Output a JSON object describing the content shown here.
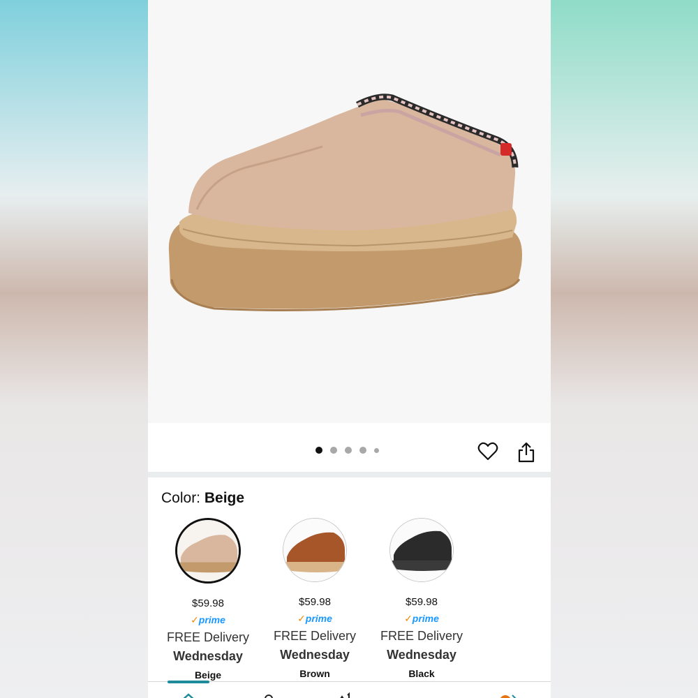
{
  "product": {
    "image_pager": {
      "total": 5,
      "active_index": 0
    }
  },
  "color": {
    "label": "Color:",
    "selected_value": "Beige"
  },
  "swatches": [
    {
      "price": "$59.98",
      "prime_label": "prime",
      "delivery_label": "FREE Delivery",
      "delivery_day": "Wednesday",
      "color_name": "Beige",
      "selected": true
    },
    {
      "price": "$59.98",
      "prime_label": "prime",
      "delivery_label": "FREE Delivery",
      "delivery_day": "Wednesday",
      "color_name": "Brown",
      "selected": false
    },
    {
      "price": "$59.98",
      "prime_label": "prime",
      "delivery_label": "FREE Delivery",
      "delivery_day": "Wednesday",
      "color_name": "Black",
      "selected": false
    }
  ],
  "icons": {
    "wishlist": "heart-icon",
    "share": "share-icon",
    "nav": [
      "home-icon",
      "profile-icon",
      "cart-icon",
      "menu-icon",
      "rufus-icon"
    ]
  },
  "colors": {
    "selected_border": "#111111",
    "prime_blue": "#1a98ff",
    "prime_check": "#f08804",
    "nav_indicator": "#1f8a99"
  }
}
